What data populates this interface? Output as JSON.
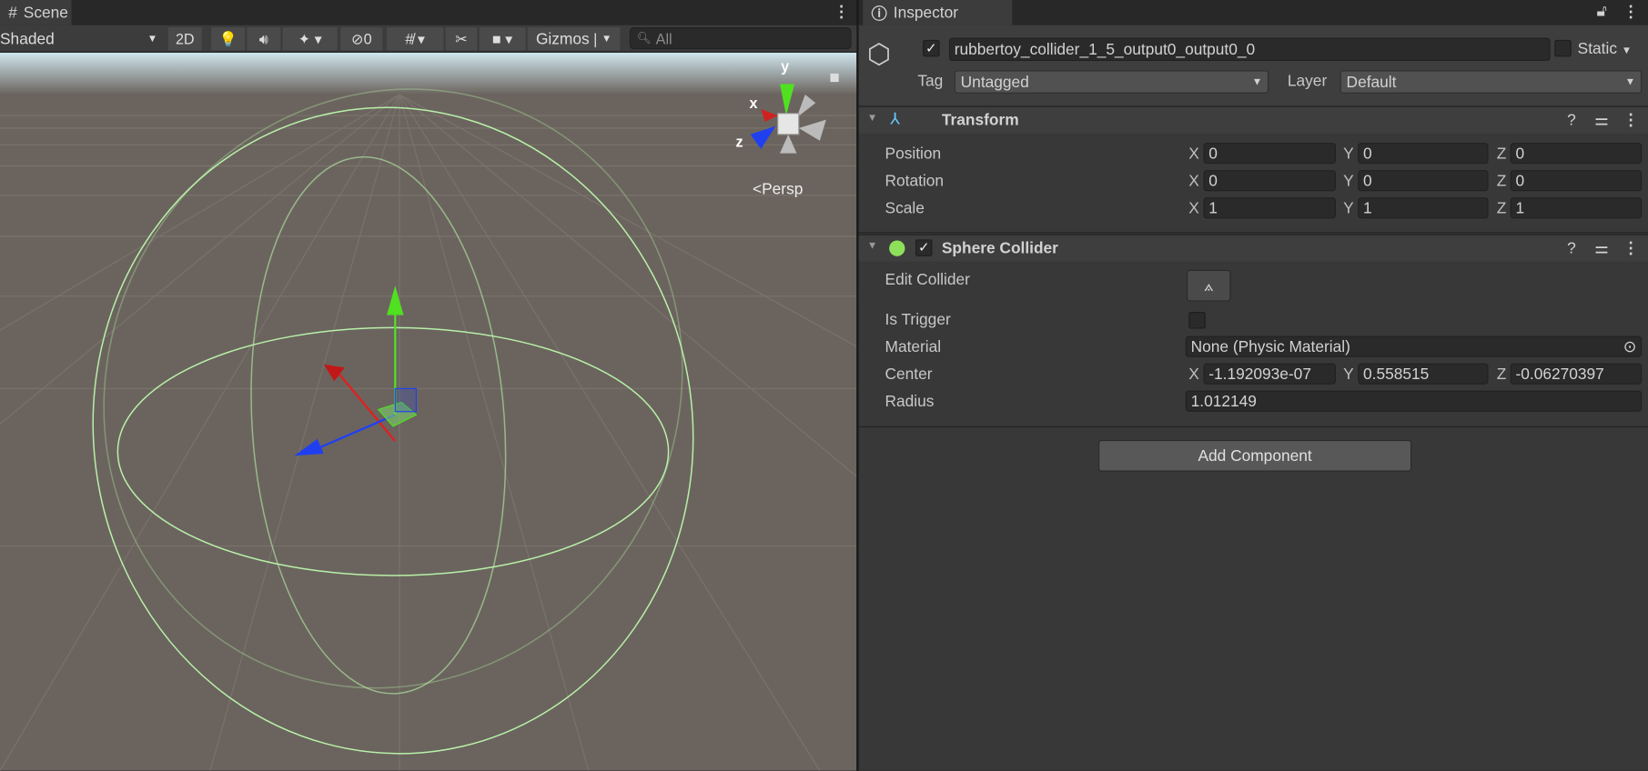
{
  "scene": {
    "tab_label": "Scene",
    "toolbar": {
      "shading_mode": "Shaded",
      "twod_label": "2D",
      "hidden_count": "0",
      "gizmos_label": "Gizmos",
      "search_placeholder": "All"
    },
    "gizmo": {
      "x_label": "x",
      "y_label": "y",
      "z_label": "z",
      "projection": "Persp"
    }
  },
  "inspector": {
    "tab_label": "Inspector",
    "object": {
      "active": true,
      "name": "rubbertoy_collider_1_5_output0_output0_0",
      "static_label": "Static",
      "tag_label": "Tag",
      "tag_value": "Untagged",
      "layer_label": "Layer",
      "layer_value": "Default"
    },
    "transform": {
      "title": "Transform",
      "rows": [
        {
          "label": "Position",
          "x": "0",
          "y": "0",
          "z": "0"
        },
        {
          "label": "Rotation",
          "x": "0",
          "y": "0",
          "z": "0"
        },
        {
          "label": "Scale",
          "x": "1",
          "y": "1",
          "z": "1"
        }
      ]
    },
    "sphere_collider": {
      "title": "Sphere Collider",
      "enabled": true,
      "edit_collider_label": "Edit Collider",
      "is_trigger_label": "Is Trigger",
      "is_trigger": false,
      "material_label": "Material",
      "material_value": "None (Physic Material)",
      "center_label": "Center",
      "center": {
        "x": "-1.192093e-07",
        "y": "0.558515",
        "z": "-0.06270397"
      },
      "radius_label": "Radius",
      "radius": "1.012149"
    },
    "axis_labels": {
      "x": "X",
      "y": "Y",
      "z": "Z"
    },
    "add_component_label": "Add Component"
  },
  "colors": {
    "collider_wire": "#b8f0a8",
    "x_axis": "#e02020",
    "y_axis": "#50e020",
    "z_axis": "#2040f0"
  }
}
